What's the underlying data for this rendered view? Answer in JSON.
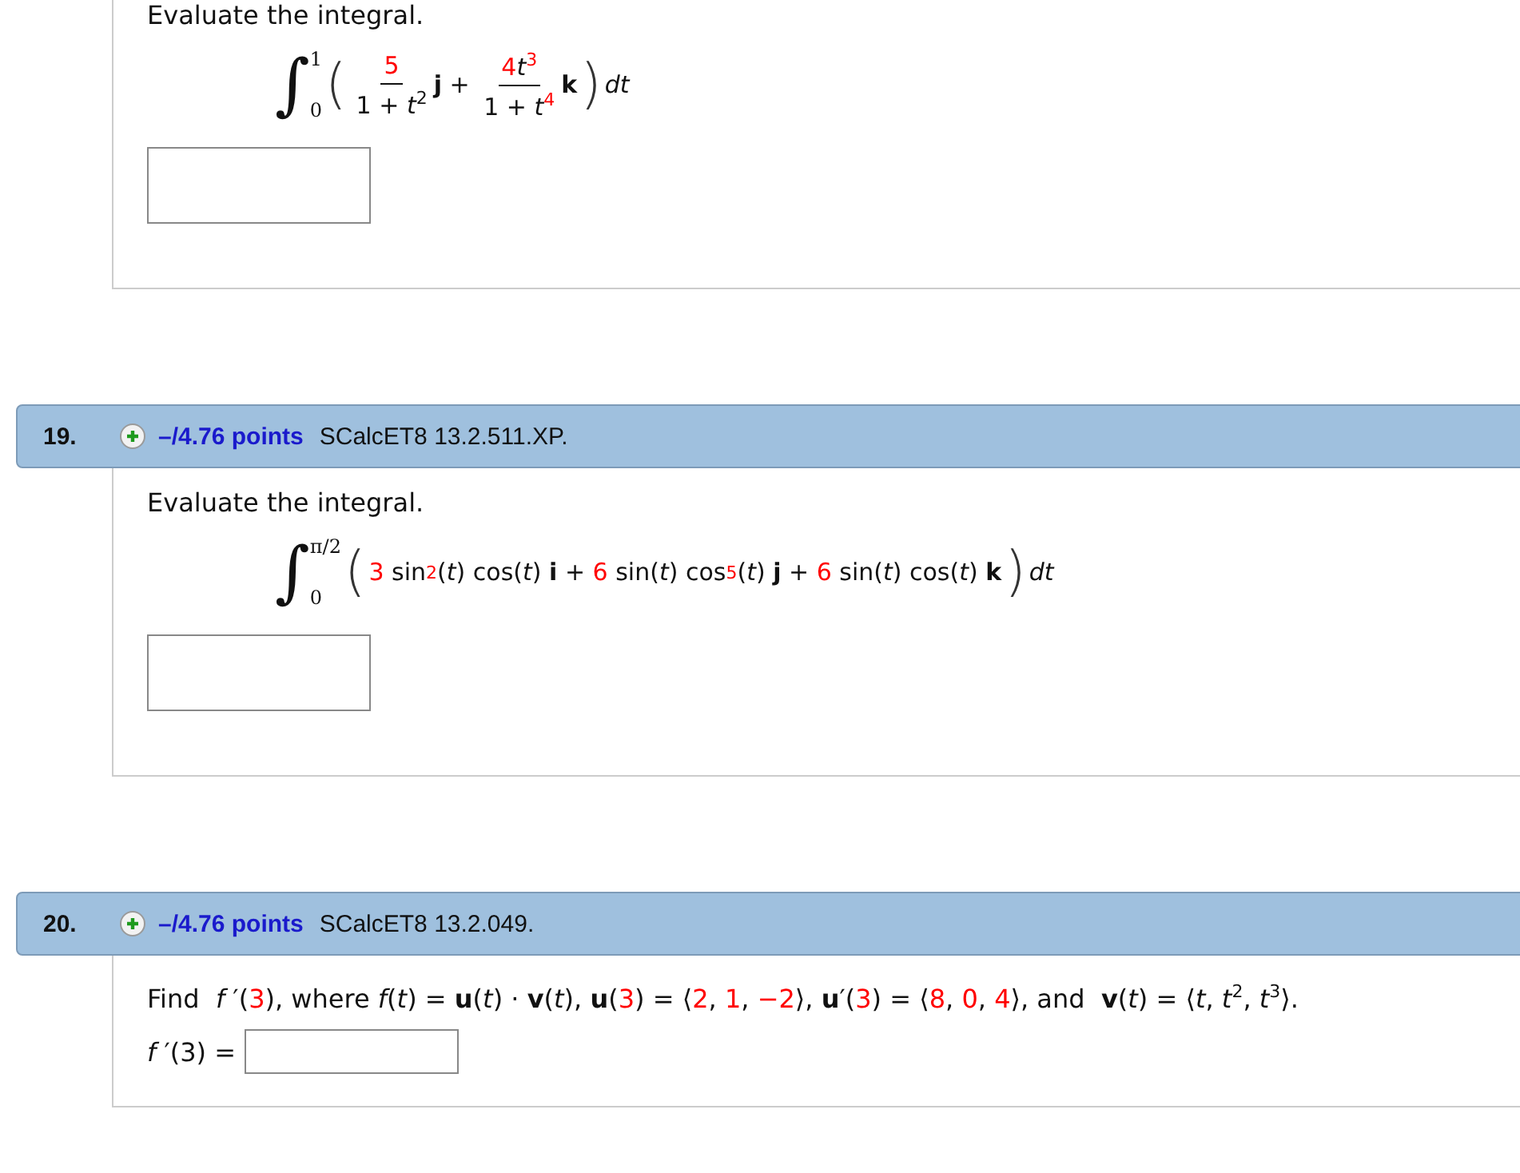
{
  "problems": [
    {
      "body": [
        {
          "kind": "prompt",
          "text": "Evaluate the integral."
        },
        {
          "kind": "formula",
          "tokens": [
            {
              "kind": "integral",
              "sign": "∫",
              "upper": "1",
              "lower": "0"
            },
            {
              "kind": "paren",
              "t": "("
            },
            {
              "kind": "frac",
              "num": [
                {
                  "kind": "red",
                  "t": "5"
                }
              ],
              "den": [
                {
                  "kind": "plain",
                  "t": "1 + "
                },
                {
                  "kind": "italic",
                  "t": "t"
                },
                {
                  "kind": "sup",
                  "t": "2"
                }
              ]
            },
            {
              "kind": "bold",
              "t": "j"
            },
            {
              "kind": "plain",
              "t": " + "
            },
            {
              "kind": "frac",
              "num": [
                {
                  "kind": "red",
                  "t": "4"
                },
                {
                  "kind": "italic",
                  "t": "t"
                },
                {
                  "kind": "red-sup",
                  "t": "3"
                }
              ],
              "den": [
                {
                  "kind": "plain",
                  "t": "1 + "
                },
                {
                  "kind": "italic",
                  "t": "t"
                },
                {
                  "kind": "red-sup",
                  "t": "4"
                }
              ]
            },
            {
              "kind": "bold",
              "t": "k"
            },
            {
              "kind": "paren",
              "t": ")"
            },
            {
              "kind": "italic",
              "t": "dt"
            }
          ]
        },
        {
          "kind": "answer"
        }
      ]
    },
    {
      "header": {
        "number": "19.",
        "points": "–/4.76 points",
        "code": "SCalcET8 13.2.511.XP."
      },
      "body": [
        {
          "kind": "prompt",
          "text": "Evaluate the integral."
        },
        {
          "kind": "formula",
          "tokens": [
            {
              "kind": "integral",
              "sign": "∫",
              "upper": "π/2",
              "lower": "0"
            },
            {
              "kind": "paren",
              "t": "("
            },
            {
              "kind": "red",
              "t": "3"
            },
            {
              "kind": "plain",
              "t": " sin"
            },
            {
              "kind": "red-sup",
              "t": "2"
            },
            {
              "kind": "plain",
              "t": "("
            },
            {
              "kind": "italic",
              "t": "t"
            },
            {
              "kind": "plain",
              "t": ") cos("
            },
            {
              "kind": "italic",
              "t": "t"
            },
            {
              "kind": "plain",
              "t": ") "
            },
            {
              "kind": "bold",
              "t": "i"
            },
            {
              "kind": "plain",
              "t": " + "
            },
            {
              "kind": "red",
              "t": "6"
            },
            {
              "kind": "plain",
              "t": " sin("
            },
            {
              "kind": "italic",
              "t": "t"
            },
            {
              "kind": "plain",
              "t": ") cos"
            },
            {
              "kind": "red-sup",
              "t": "5"
            },
            {
              "kind": "plain",
              "t": "("
            },
            {
              "kind": "italic",
              "t": "t"
            },
            {
              "kind": "plain",
              "t": ") "
            },
            {
              "kind": "bold",
              "t": "j"
            },
            {
              "kind": "plain",
              "t": " + "
            },
            {
              "kind": "red",
              "t": "6"
            },
            {
              "kind": "plain",
              "t": " sin("
            },
            {
              "kind": "italic",
              "t": "t"
            },
            {
              "kind": "plain",
              "t": ") cos("
            },
            {
              "kind": "italic",
              "t": "t"
            },
            {
              "kind": "plain",
              "t": ") "
            },
            {
              "kind": "bold",
              "t": "k"
            },
            {
              "kind": "paren",
              "t": ")"
            },
            {
              "kind": "italic",
              "t": "dt"
            }
          ]
        },
        {
          "kind": "answer"
        }
      ]
    },
    {
      "header": {
        "number": "20.",
        "points": "–/4.76 points",
        "code": "SCalcET8 13.2.049."
      },
      "body": [
        {
          "kind": "sentence",
          "tokens": [
            {
              "kind": "plain",
              "t": "Find  "
            },
            {
              "kind": "italic",
              "t": "f"
            },
            {
              "kind": "plain",
              "t": " ′("
            },
            {
              "kind": "red",
              "t": "3"
            },
            {
              "kind": "plain",
              "t": "), where "
            },
            {
              "kind": "italic",
              "t": "f"
            },
            {
              "kind": "plain",
              "t": "("
            },
            {
              "kind": "italic",
              "t": "t"
            },
            {
              "kind": "plain",
              "t": ") = "
            },
            {
              "kind": "bold",
              "t": "u"
            },
            {
              "kind": "plain",
              "t": "("
            },
            {
              "kind": "italic",
              "t": "t"
            },
            {
              "kind": "plain",
              "t": ") · "
            },
            {
              "kind": "bold",
              "t": "v"
            },
            {
              "kind": "plain",
              "t": "("
            },
            {
              "kind": "italic",
              "t": "t"
            },
            {
              "kind": "plain",
              "t": "), "
            },
            {
              "kind": "bold",
              "t": "u"
            },
            {
              "kind": "plain",
              "t": "("
            },
            {
              "kind": "red",
              "t": "3"
            },
            {
              "kind": "plain",
              "t": ") = ⟨"
            },
            {
              "kind": "red",
              "t": "2"
            },
            {
              "kind": "plain",
              "t": ", "
            },
            {
              "kind": "red",
              "t": "1"
            },
            {
              "kind": "plain",
              "t": ", "
            },
            {
              "kind": "red",
              "t": "−2"
            },
            {
              "kind": "plain",
              "t": "⟩, "
            },
            {
              "kind": "bold",
              "t": "u"
            },
            {
              "kind": "plain",
              "t": "′("
            },
            {
              "kind": "red",
              "t": "3"
            },
            {
              "kind": "plain",
              "t": ") = ⟨"
            },
            {
              "kind": "red",
              "t": "8"
            },
            {
              "kind": "plain",
              "t": ", "
            },
            {
              "kind": "red",
              "t": "0"
            },
            {
              "kind": "plain",
              "t": ", "
            },
            {
              "kind": "red",
              "t": "4"
            },
            {
              "kind": "plain",
              "t": "⟩, and  "
            },
            {
              "kind": "bold",
              "t": "v"
            },
            {
              "kind": "plain",
              "t": "("
            },
            {
              "kind": "italic",
              "t": "t"
            },
            {
              "kind": "plain",
              "t": ") = ⟨"
            },
            {
              "kind": "italic",
              "t": "t"
            },
            {
              "kind": "plain",
              "t": ", "
            },
            {
              "kind": "italic",
              "t": "t"
            },
            {
              "kind": "sup",
              "t": "2"
            },
            {
              "kind": "plain",
              "t": ", "
            },
            {
              "kind": "italic",
              "t": "t"
            },
            {
              "kind": "sup",
              "t": "3"
            },
            {
              "kind": "plain",
              "t": "⟩."
            }
          ]
        },
        {
          "kind": "answer",
          "label": [
            {
              "kind": "italic",
              "t": "f"
            },
            {
              "kind": "plain",
              "t": " ′(3) = "
            }
          ]
        }
      ]
    }
  ]
}
